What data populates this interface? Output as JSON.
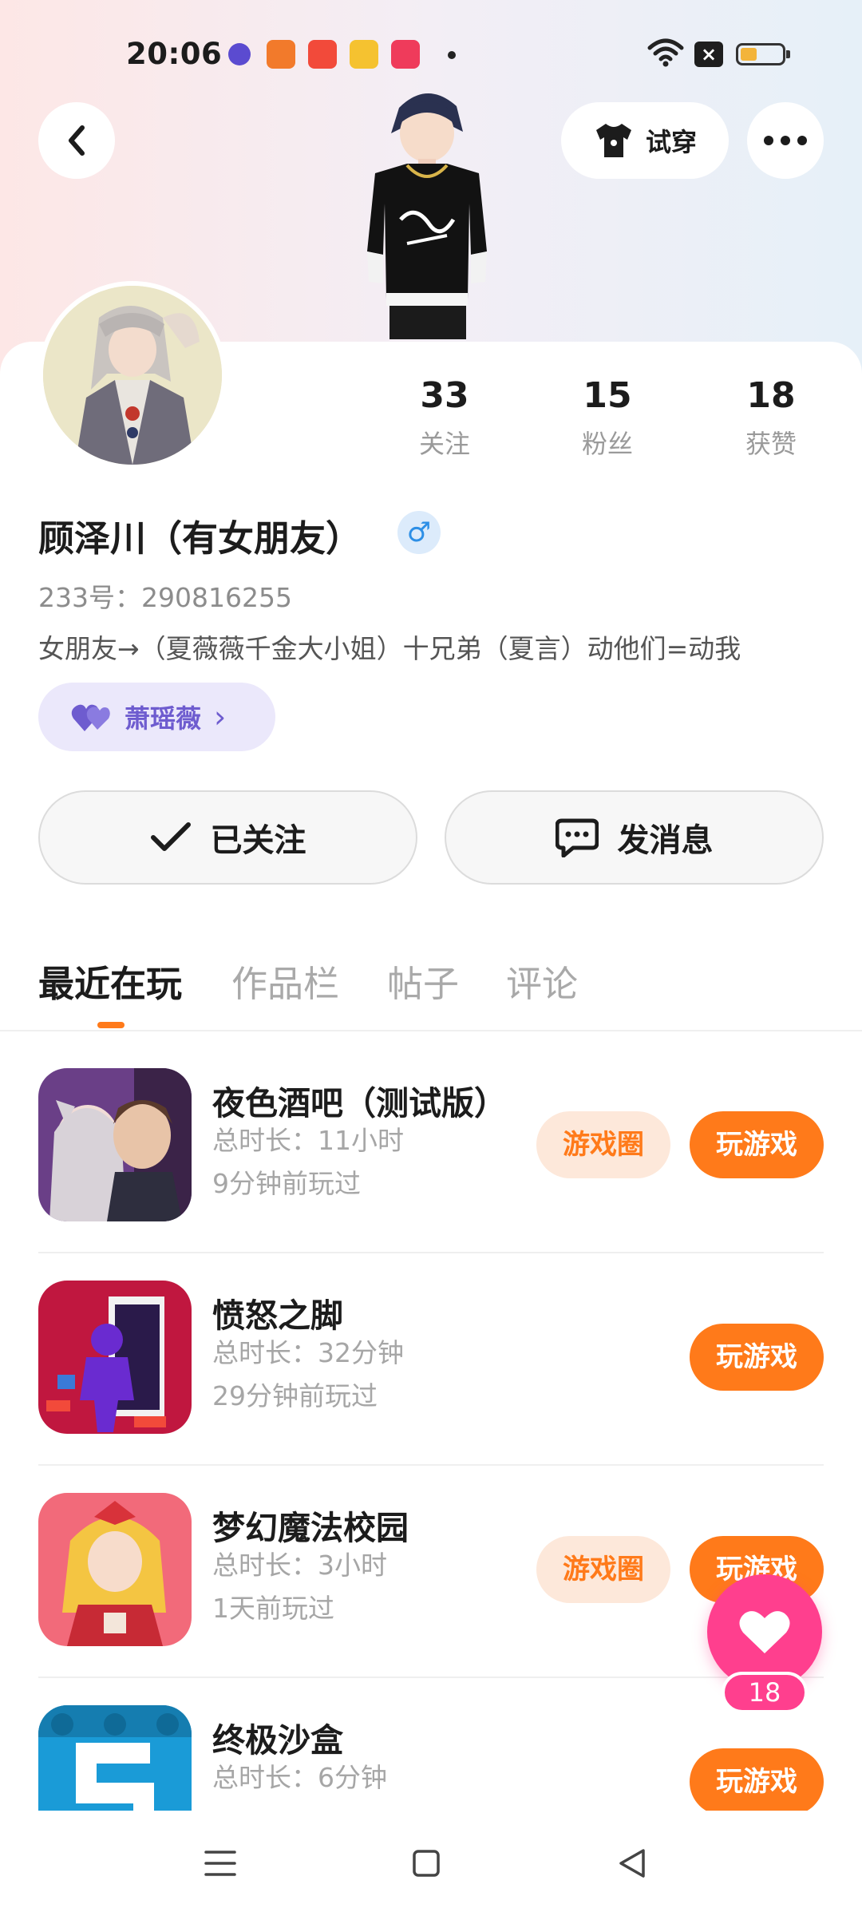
{
  "status_bar": {
    "time": "20:06",
    "app_icons": [
      {
        "name": "browser-app-icon",
        "color": "#5b4bd0"
      },
      {
        "name": "video-app-icon",
        "color": "#f27a2b"
      },
      {
        "name": "music-app-icon",
        "color": "#f24a3a"
      },
      {
        "name": "reader-app-icon",
        "color": "#f5c230"
      },
      {
        "name": "play-app-icon",
        "color": "#ef3b5b"
      }
    ],
    "battery_color": "#f3b43a"
  },
  "header": {
    "tryon_label": "试穿"
  },
  "profile": {
    "stats": [
      {
        "num": "33",
        "label": "关注"
      },
      {
        "num": "15",
        "label": "粉丝"
      },
      {
        "num": "18",
        "label": "获赞"
      }
    ],
    "name": "顾泽川（有女朋友）",
    "gender_symbol": "♂",
    "uid": "233号：290816255",
    "bio": "女朋友→（夏薇薇千金大小姐）十兄弟（夏言）动他们=动我",
    "cp_name": "萧瑶薇",
    "cp_arrow": "›"
  },
  "actions": {
    "follow_label": "已关注",
    "message_label": "发消息"
  },
  "tabs": [
    {
      "label": "最近在玩",
      "active": true
    },
    {
      "label": "作品栏",
      "active": false
    },
    {
      "label": "帖子",
      "active": false
    },
    {
      "label": "评论",
      "active": false
    }
  ],
  "games": [
    {
      "title": "夜色酒吧（测试版）",
      "duration": "总时长：11小时",
      "last_played": "9分钟前玩过",
      "circle_label": "游戏圈",
      "play_label": "玩游戏"
    },
    {
      "title": "愤怒之脚",
      "duration": "总时长：32分钟",
      "last_played": "29分钟前玩过",
      "play_label": "玩游戏"
    },
    {
      "title": "梦幻魔法校园",
      "duration": "总时长：3小时",
      "last_played": "1天前玩过",
      "circle_label": "游戏圈",
      "play_label": "玩游戏"
    },
    {
      "title": "终极沙盒",
      "duration": "总时长：6分钟",
      "play_label": "玩游戏"
    }
  ],
  "like_fab": {
    "count": "18"
  },
  "colors": {
    "accent": "#ff7a1a",
    "like": "#ff3f8e",
    "cp_purple": "#6e5ccf"
  }
}
